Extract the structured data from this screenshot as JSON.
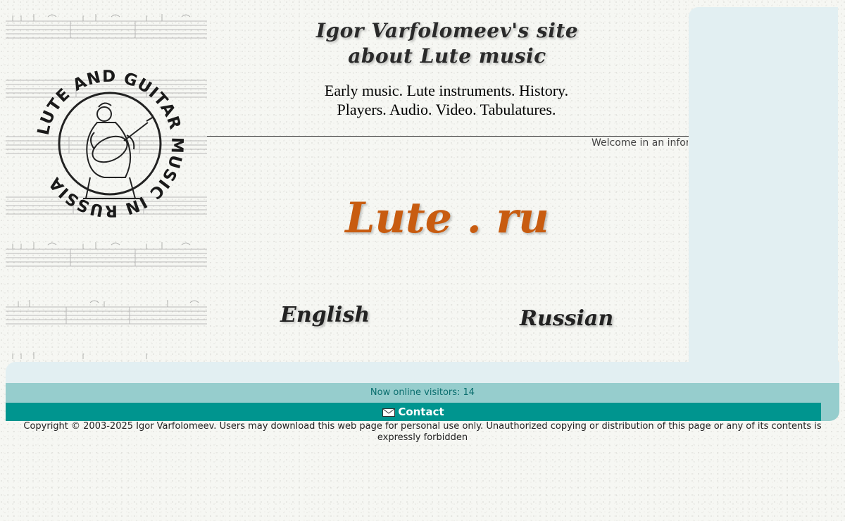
{
  "header": {
    "title_line1": "Igor Varfolomeev's site",
    "title_line2": "about Lute music",
    "tagline_line1": "Early music. Lute instruments. History.",
    "tagline_line2": "Players. Audio. Video. Tabulatures.",
    "ticker": "Welcome in an informational site about lute music"
  },
  "emblem": {
    "text": "LUTE AND GUITAR MUSIC IN RUSSIA",
    "icon": "lute-player-emblem"
  },
  "logo": {
    "text": "Lute . ru",
    "color": "#c85c10"
  },
  "languages": {
    "english": "English",
    "russian": "Russian"
  },
  "footer": {
    "online_visitors": "Now online visitors: 14",
    "contact_label": "Contact",
    "contact_icon": "envelope-icon",
    "copyright": "Copyright © 2003-2025 Igor Varfolomeev. Users may download this web page for personal use only. Unauthorized copying or distribution of this page or any of its contents is expressly forbidden"
  },
  "colors": {
    "panel": "#e2eff2",
    "online_band": "#96cdcd",
    "contact_band": "#00958f",
    "online_text": "#0a6e6e"
  }
}
